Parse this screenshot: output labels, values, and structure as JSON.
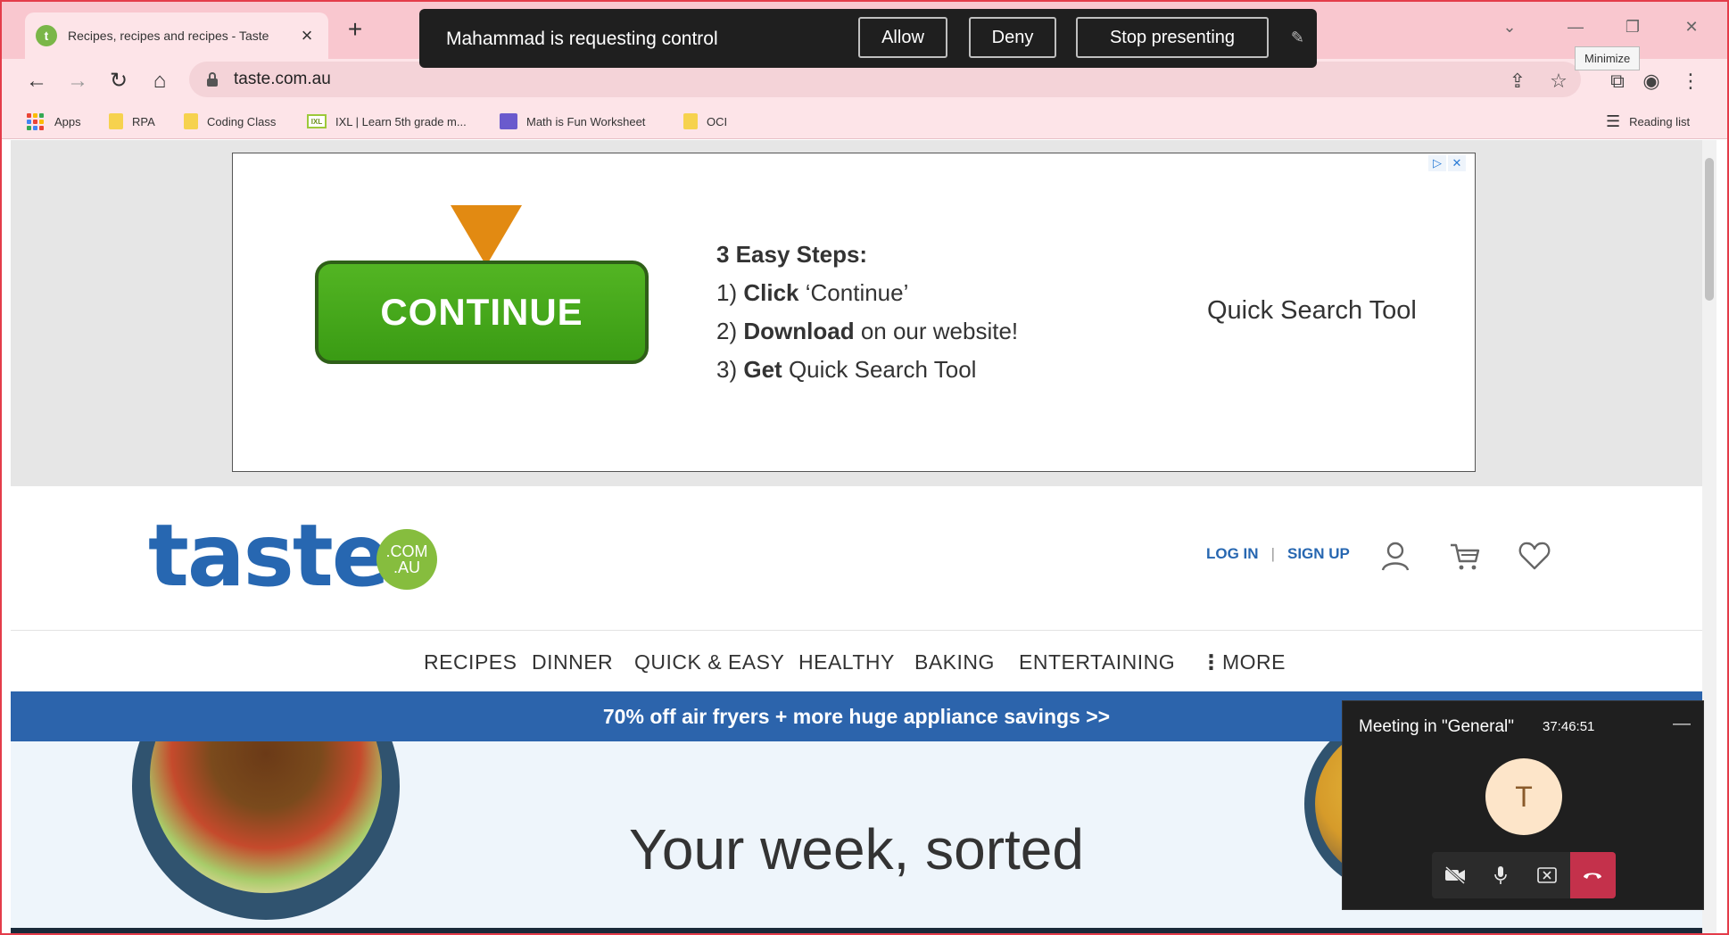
{
  "browser": {
    "tab_title": "Recipes, recipes and recipes - Taste",
    "tab_favicon_letter": "t",
    "url": "taste.com.au",
    "tooltip": "Minimize",
    "bookmarks": [
      {
        "label": "Apps",
        "icon": "apps-icon"
      },
      {
        "label": "RPA",
        "icon": "folder-icon"
      },
      {
        "label": "Coding Class",
        "icon": "folder-icon"
      },
      {
        "label": "IXL | Learn 5th grade m...",
        "icon": "ixl-icon"
      },
      {
        "label": "Math is Fun Worksheet",
        "icon": "math-icon"
      },
      {
        "label": "OCI",
        "icon": "folder-icon"
      }
    ],
    "reading_list": "Reading list",
    "accent_color": "#f9c7cf"
  },
  "presenting": {
    "message": "Mahammad is requesting control",
    "allow": "Allow",
    "deny": "Deny",
    "stop": "Stop presenting"
  },
  "ad": {
    "cta": "CONTINUE",
    "heading": "3 Easy Steps:",
    "steps": [
      {
        "num": "1)",
        "bold": "Click",
        "rest": "‘Continue’"
      },
      {
        "num": "2)",
        "bold": "Download",
        "rest": "on our website!"
      },
      {
        "num": "3)",
        "bold": "Get",
        "rest": "Quick Search Tool"
      }
    ],
    "tool_name": "Quick Search Tool"
  },
  "site": {
    "logo_word": "taste",
    "logo_badge_top": ".COM",
    "logo_badge_bottom": ".AU",
    "login": "LOG IN",
    "divider": "|",
    "signup": "SIGN UP",
    "brand_color": "#2767b1",
    "nav": [
      "RECIPES",
      "DINNER",
      "QUICK & EASY",
      "HEALTHY",
      "BAKING",
      "ENTERTAINING",
      "MORE"
    ],
    "banner": "70% off air fryers + more huge appliance savings >>",
    "hero_title": "Your week, sorted"
  },
  "meeting": {
    "title": "Meeting in \"General\"",
    "time": "37:46:51",
    "avatar_letter": "T"
  }
}
